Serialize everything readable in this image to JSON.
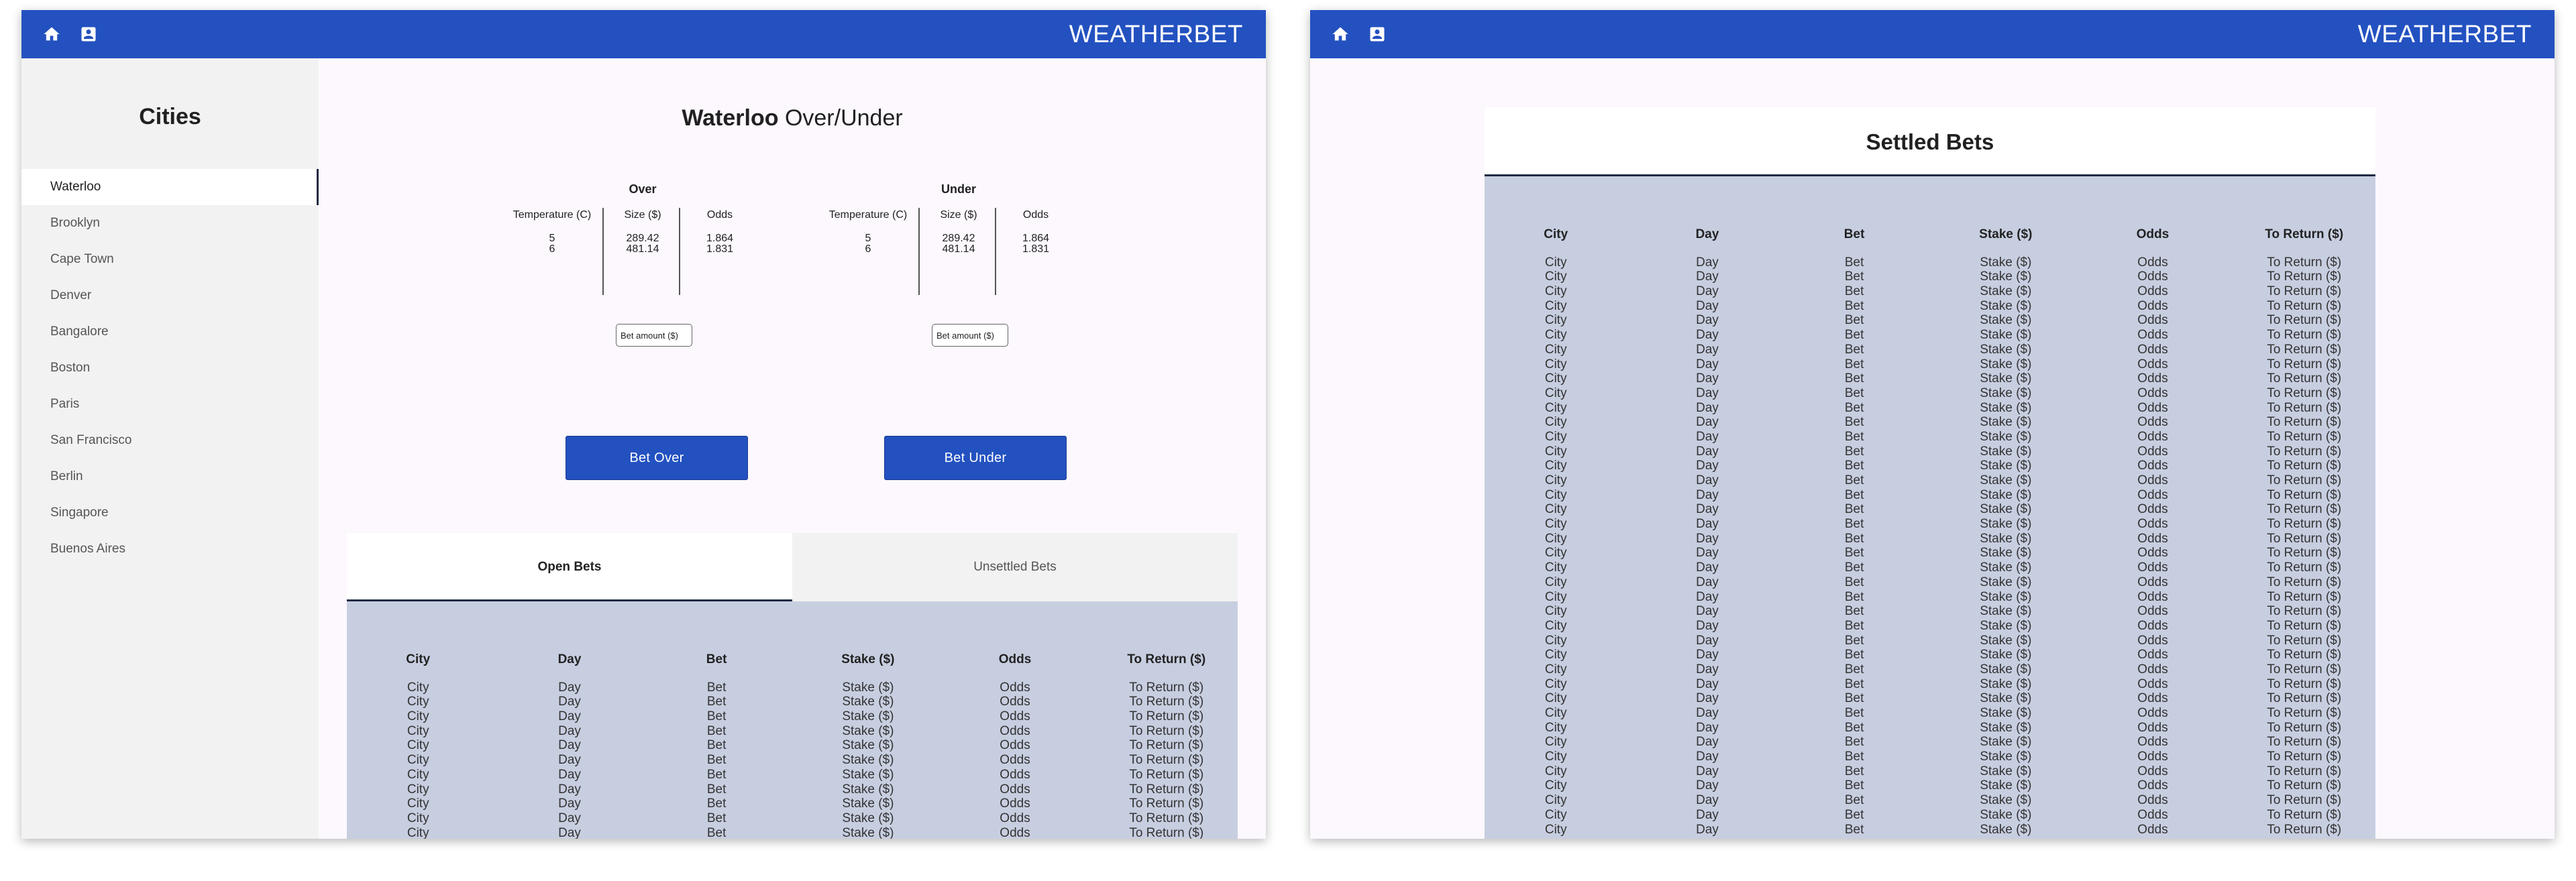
{
  "brand": "WEATHERBET",
  "icons": {
    "home": "home-icon",
    "profile": "account-box-icon"
  },
  "colors": {
    "appbar": "#2351c0",
    "button": "#2351c0",
    "table_bg": "#c7cee0",
    "page_bg": "#fcf8fe",
    "sidebar_bg": "#f2f2f2"
  },
  "sidebar": {
    "title": "Cities",
    "items": [
      {
        "label": "Waterloo",
        "active": true
      },
      {
        "label": "Brooklyn"
      },
      {
        "label": "Cape Town"
      },
      {
        "label": "Denver"
      },
      {
        "label": "Bangalore"
      },
      {
        "label": "Boston"
      },
      {
        "label": "Paris"
      },
      {
        "label": "San Francisco"
      },
      {
        "label": "Berlin"
      },
      {
        "label": "Singapore"
      },
      {
        "label": "Buenos Aires"
      }
    ]
  },
  "market": {
    "city": "Waterloo",
    "suffix": "Over/Under",
    "over": {
      "title": "Over",
      "columns": [
        "Temperature (C)",
        "Size ($)",
        "Odds"
      ],
      "temperature": [
        "5",
        "6"
      ],
      "size": [
        "289.42",
        "481.14"
      ],
      "odds": [
        "1.864",
        "1.831"
      ],
      "input_placeholder": "Bet amount ($)",
      "button": "Bet Over"
    },
    "under": {
      "title": "Under",
      "columns": [
        "Temperature (C)",
        "Size ($)",
        "Odds"
      ],
      "temperature": [
        "5",
        "6"
      ],
      "size": [
        "289.42",
        "481.14"
      ],
      "odds": [
        "1.864",
        "1.831"
      ],
      "input_placeholder": "Bet amount ($)",
      "button": "Bet Under"
    }
  },
  "tabs": [
    {
      "label": "Open Bets",
      "active": true
    },
    {
      "label": "Unsettled Bets",
      "active": false
    }
  ],
  "open_bets": {
    "headers": [
      "City",
      "Day",
      "Bet",
      "Stake ($)",
      "Odds",
      "To Return ($)"
    ],
    "row": [
      "City",
      "Day",
      "Bet",
      "Stake ($)",
      "Odds",
      "To Return ($)"
    ],
    "row_count": 11
  },
  "settled": {
    "title": "Settled Bets",
    "headers": [
      "City",
      "Day",
      "Bet",
      "Stake ($)",
      "Odds",
      "To Return ($)"
    ],
    "row": [
      "City",
      "Day",
      "Bet",
      "Stake ($)",
      "Odds",
      "To Return ($)"
    ],
    "row_count": 40
  }
}
